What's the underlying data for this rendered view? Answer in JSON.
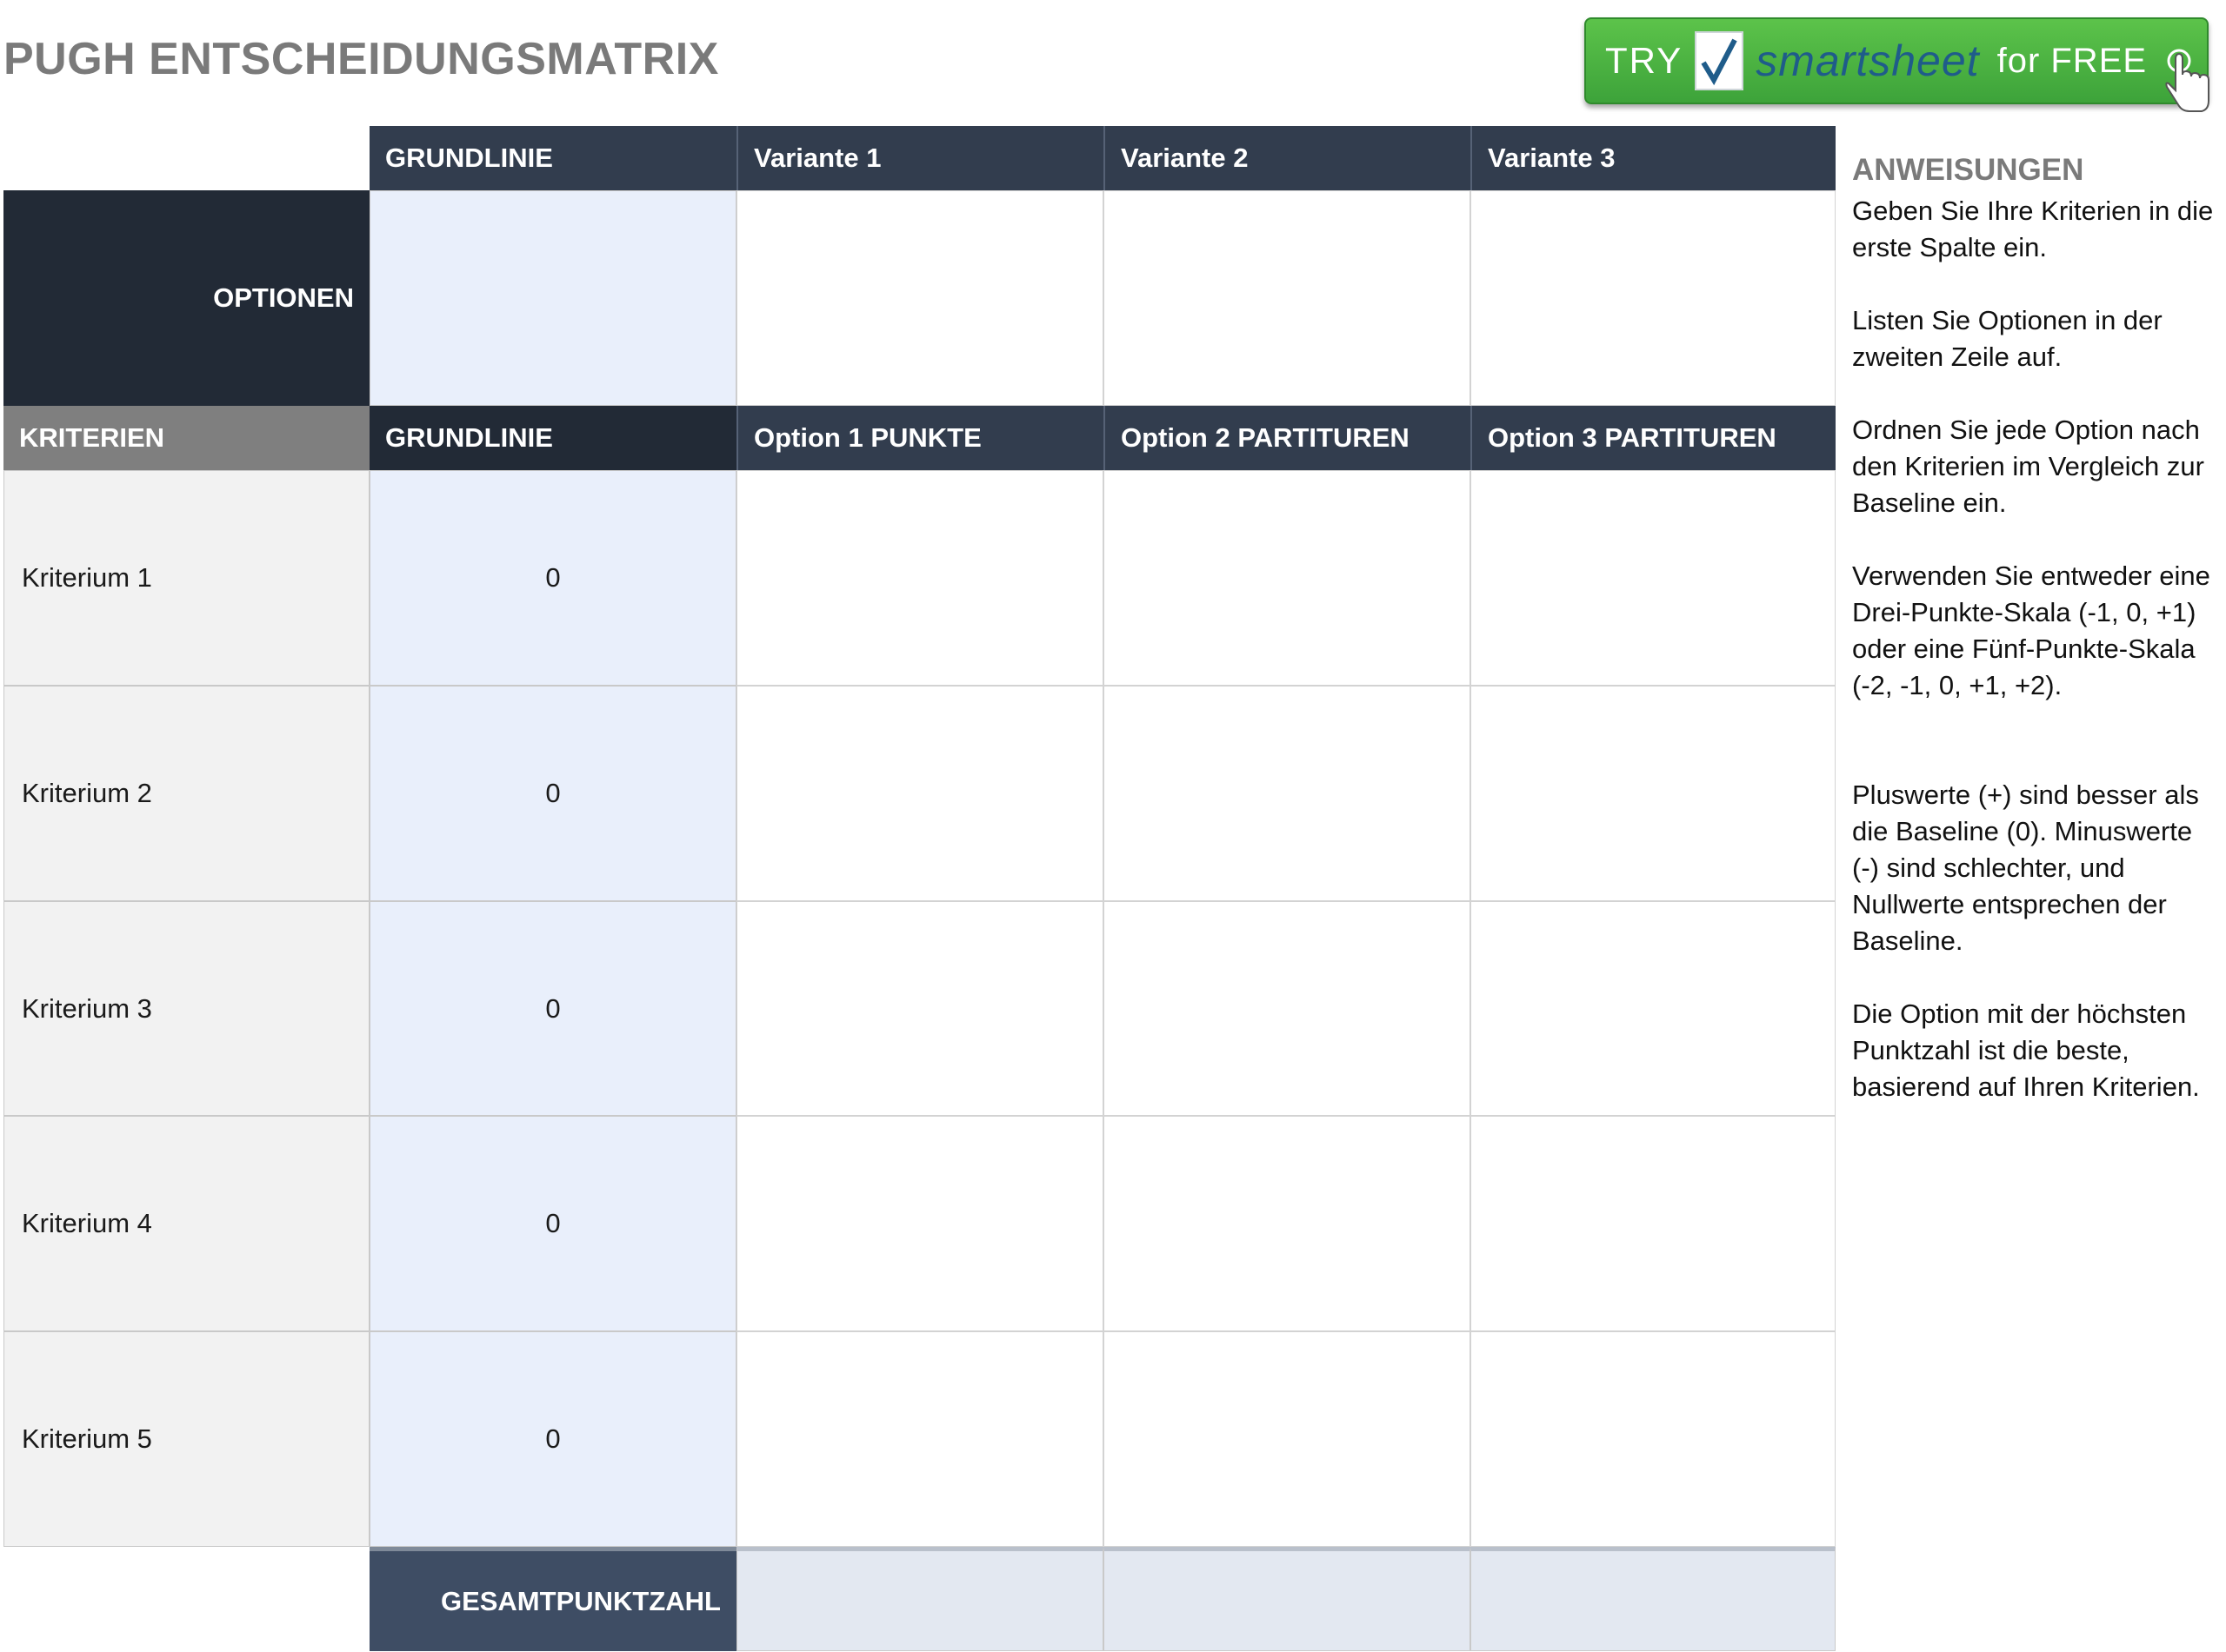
{
  "title": "PUGH ENTSCHEIDUNGSMATRIX",
  "promo": {
    "try": "TRY",
    "brand": "smartsheet",
    "free": "for FREE"
  },
  "header_row": [
    "GRUNDLINIE",
    "Variante 1",
    "Variante 2",
    "Variante 3"
  ],
  "options_label": "OPTIONEN",
  "criteria_header": "KRITERIEN",
  "score_headers": [
    "GRUNDLINIE",
    "Option 1 PUNKTE",
    "Option 2 PARTITUREN",
    "Option 3 PARTITUREN"
  ],
  "criteria": [
    {
      "name": "Kriterium 1",
      "baseline": "0"
    },
    {
      "name": "Kriterium 2",
      "baseline": "0"
    },
    {
      "name": "Kriterium 3",
      "baseline": "0"
    },
    {
      "name": "Kriterium 4",
      "baseline": "0"
    },
    {
      "name": "Kriterium 5",
      "baseline": "0"
    }
  ],
  "total_label": "GESAMTPUNKTZAHL",
  "instructions": {
    "heading": "ANWEISUNGEN",
    "paragraphs": [
      "Geben Sie Ihre Kriterien in die erste Spalte ein.",
      "Listen Sie Optionen in der zweiten Zeile auf.",
      "Ordnen Sie jede Option nach den Kriterien im Vergleich zur Baseline ein.",
      "Verwenden Sie entweder eine Drei-Punkte-Skala (-1, 0, +1) oder eine Fünf-Punkte-Skala (-2, -1, 0, +1, +2).",
      "Pluswerte (+) sind besser als die Baseline (0). Minuswerte (-) sind schlechter, und Nullwerte entsprechen der Baseline.",
      "Die Option mit der höchsten Punktzahl ist die beste, basierend auf Ihren Kriterien."
    ]
  }
}
